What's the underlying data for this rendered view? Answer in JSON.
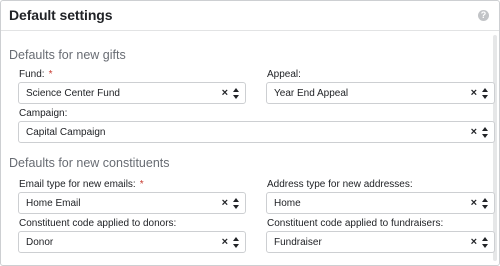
{
  "panel": {
    "title": "Default settings",
    "help_icon": "question-circle-icon"
  },
  "gifts": {
    "heading": "Defaults for new gifts",
    "fund": {
      "label": "Fund:",
      "required_mark": "*",
      "value": "Science Center Fund"
    },
    "appeal": {
      "label": "Appeal:",
      "value": "Year End Appeal"
    },
    "campaign": {
      "label": "Campaign:",
      "value": "Capital Campaign"
    }
  },
  "constituents": {
    "heading": "Defaults for new constituents",
    "email_type": {
      "label": "Email type for new emails:",
      "required_mark": "*",
      "value": "Home Email"
    },
    "address_type": {
      "label": "Address type for new addresses:",
      "value": "Home"
    },
    "donor_code": {
      "label": "Constituent code applied to donors:",
      "value": "Donor"
    },
    "fundraiser_code": {
      "label": "Constituent code applied to fundraisers:",
      "value": "Fundraiser"
    }
  },
  "select_controls": {
    "clear_glyph": "×"
  }
}
